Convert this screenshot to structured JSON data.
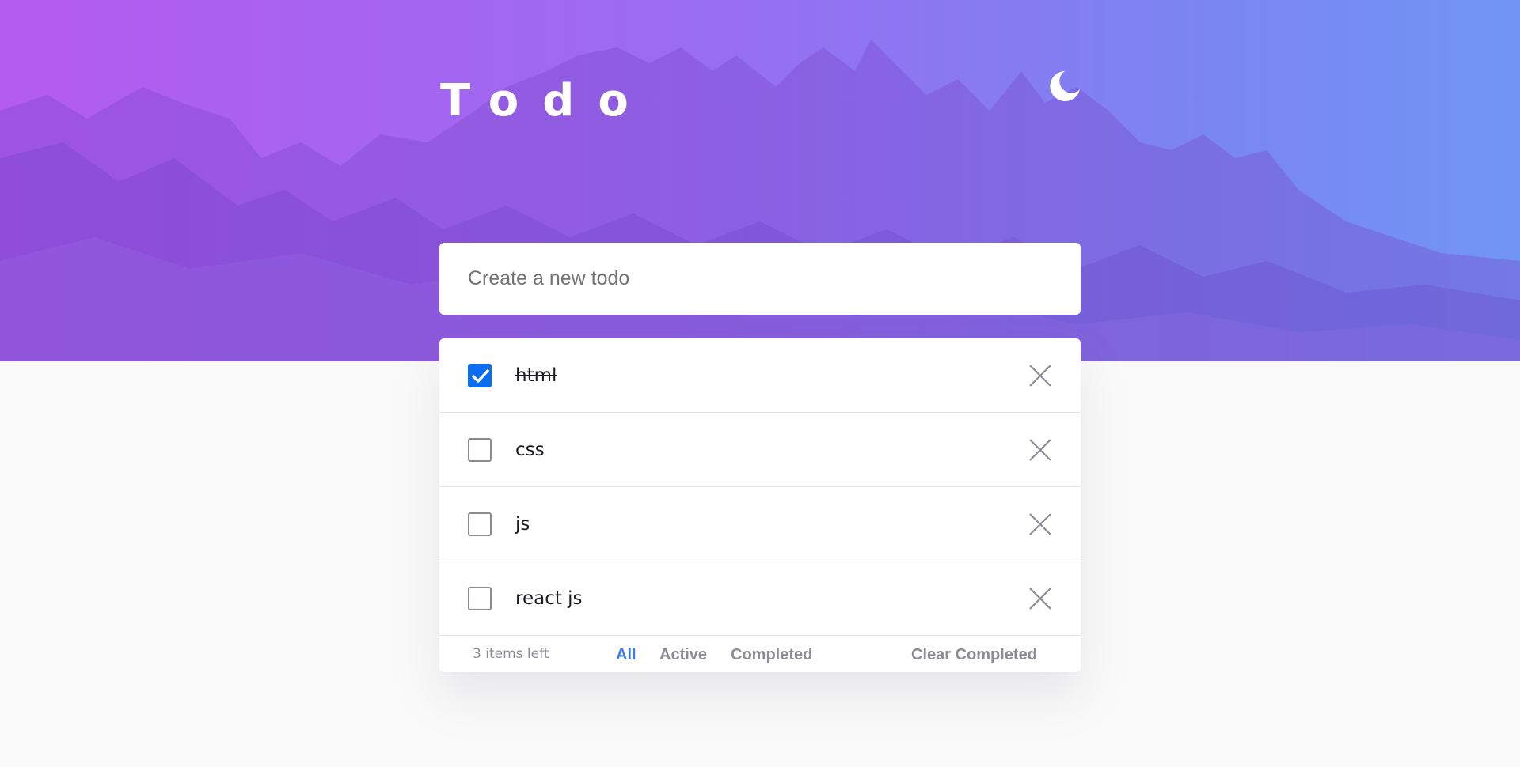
{
  "header": {
    "title": "Todo",
    "theme_icon": "moon-icon"
  },
  "new_todo": {
    "placeholder": "Create a new todo",
    "value": ""
  },
  "todos": [
    {
      "label": "html",
      "completed": true
    },
    {
      "label": "css",
      "completed": false
    },
    {
      "label": "js",
      "completed": false
    },
    {
      "label": "react js",
      "completed": false
    }
  ],
  "footer": {
    "items_left": "3 items left",
    "filters": {
      "all": "All",
      "active": "Active",
      "completed": "Completed"
    },
    "active_filter": "All",
    "clear_completed": "Clear Completed"
  },
  "colors": {
    "accent": "#3a7bf0",
    "checkbox_checked": "#0b6df0",
    "gradient_start": "#b45bf0",
    "gradient_end": "#7195f4"
  }
}
